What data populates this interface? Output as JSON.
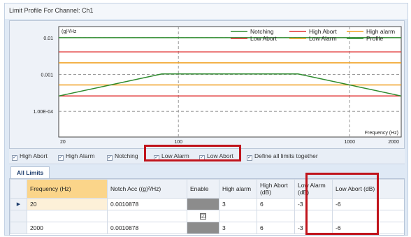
{
  "window": {
    "title": "Limit Profile For Channel: Ch1"
  },
  "chart_data": {
    "type": "line",
    "xscale": "log",
    "yscale": "log",
    "xlim": [
      20,
      2000
    ],
    "ylim": [
      2e-05,
      0.02
    ],
    "x_ticks": [
      {
        "value": 20,
        "label": "20"
      },
      {
        "value": 100,
        "label": "100"
      },
      {
        "value": 1000,
        "label": "1000"
      },
      {
        "value": 2000,
        "label": "2000"
      }
    ],
    "y_ticks": [
      {
        "value": 0.01,
        "label": "0.01"
      },
      {
        "value": 0.001,
        "label": "0.001"
      },
      {
        "value": 0.0001,
        "label": "1.00E-04"
      }
    ],
    "ylabel": "(g)²/Hz",
    "xlabel": "Frequency (Hz)",
    "legend_position": "top-right",
    "series": [
      {
        "name": "Notching",
        "color": "#2e8b2e",
        "x": [
          20,
          2000
        ],
        "y": [
          0.01,
          0.01
        ]
      },
      {
        "name": "High Abort",
        "color": "#e03030",
        "x": [
          20,
          2000
        ],
        "y": [
          0.0041,
          0.0041
        ]
      },
      {
        "name": "High alarm",
        "color": "#f0a020",
        "x": [
          20,
          2000
        ],
        "y": [
          0.00207,
          0.00207
        ]
      },
      {
        "name": "Low Abort",
        "color": "#e03030",
        "x": [
          20,
          2000
        ],
        "y": [
          0.00026,
          0.00026
        ]
      },
      {
        "name": "Low Alarm",
        "color": "#f0a020",
        "x": [
          20,
          2000
        ],
        "y": [
          0.00052,
          0.00052
        ]
      },
      {
        "name": "Profile",
        "color": "#2e8b2e",
        "x": [
          20,
          80,
          500,
          2000
        ],
        "y": [
          0.00026,
          0.00103,
          0.00103,
          0.00026
        ]
      }
    ]
  },
  "options": {
    "high_abort": {
      "label": "High Abort",
      "checked": true
    },
    "high_alarm": {
      "label": "High Alarm",
      "checked": true
    },
    "notching": {
      "label": "Notching",
      "checked": true
    },
    "low_alarm": {
      "label": "Low Alarm",
      "checked": true
    },
    "low_abort": {
      "label": "Low Abort",
      "checked": true
    },
    "define_all": {
      "label": "Define all limits together",
      "checked": true
    }
  },
  "tabs": {
    "all_limits": "All Limits"
  },
  "table": {
    "headers": {
      "frequency": "Frequency (Hz)",
      "notch": "Notch Acc ((g)²/Hz)",
      "enable": "Enable",
      "high_alarm": "High alarm",
      "high_abort": "High Abort (dB)",
      "low_alarm": "Low Alarm (dB)",
      "low_abort": "Low Abort (dB)"
    },
    "rows": [
      {
        "marker": "▶",
        "frequency": "20",
        "notch": "0.0010878",
        "enable": "",
        "high_alarm": "3",
        "high_abort": "6",
        "low_alarm": "-3",
        "low_abort": "-6"
      },
      {
        "marker": "",
        "frequency": "",
        "notch": "",
        "enable": "☑",
        "high_alarm": "",
        "high_abort": "",
        "low_alarm": "",
        "low_abort": ""
      },
      {
        "marker": "",
        "frequency": "2000",
        "notch": "0.0010878",
        "enable": "",
        "high_alarm": "3",
        "high_abort": "6",
        "low_alarm": "-3",
        "low_abort": "-6"
      }
    ]
  },
  "colors": {
    "highlight": "#c0141c",
    "sorted_header": "#fbd58a"
  }
}
